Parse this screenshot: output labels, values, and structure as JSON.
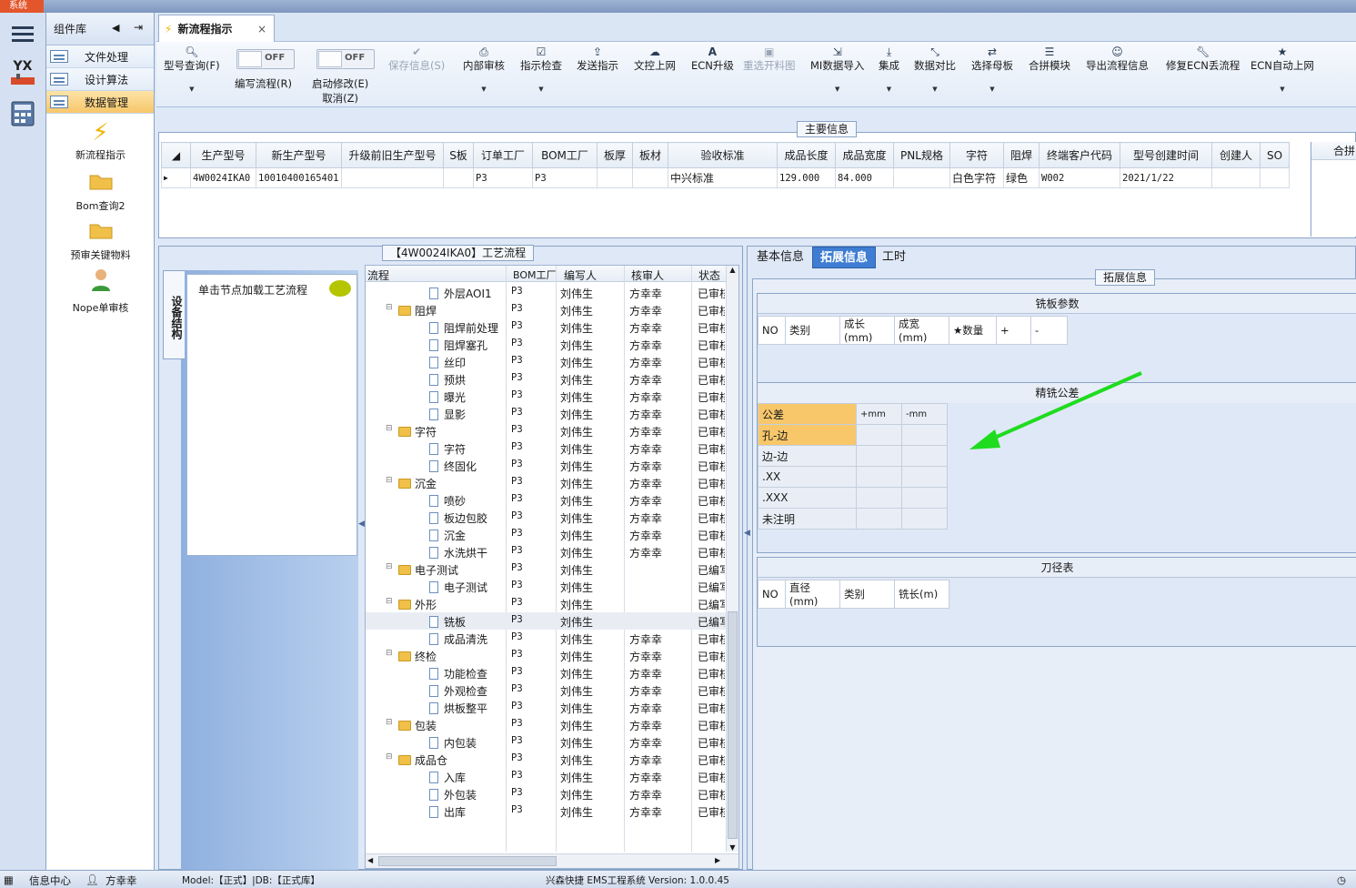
{
  "window": {
    "system_label": "系统"
  },
  "component_library": {
    "title": "组件库",
    "items": [
      {
        "label": "文件处理"
      },
      {
        "label": "设计算法"
      },
      {
        "label": "数据管理"
      }
    ],
    "tools": [
      {
        "label": "新流程指示",
        "icon": "lightning-icon"
      },
      {
        "label": "Bom查询2",
        "icon": "folder-icon"
      },
      {
        "label": "预审关键物料",
        "icon": "folder-icon"
      },
      {
        "label": "Nope单审核",
        "icon": "user-icon"
      }
    ]
  },
  "rail": {
    "logo": "YX"
  },
  "document_tab": {
    "title": "新流程指示",
    "close": "×"
  },
  "ribbon": {
    "buttons": [
      {
        "label": "型号查询(F)",
        "icon": "search-icon",
        "dropdown": true
      },
      {
        "label": "编写流程(R)",
        "toggle": "OFF"
      },
      {
        "label": "启动修改(E)",
        "label2": "取消(Z)",
        "toggle": "OFF"
      },
      {
        "label": "保存信息(S)",
        "icon": "check-icon",
        "disabled": true
      },
      {
        "label": "内部审核",
        "icon": "print-icon",
        "dropdown": true
      },
      {
        "label": "指示检查",
        "icon": "checkbox-icon",
        "dropdown": true
      },
      {
        "label": "发送指示",
        "icon": "upload-icon"
      },
      {
        "label": "文控上网",
        "icon": "cloud-upload-icon"
      },
      {
        "label": "ECN升级",
        "icon": "font-icon"
      },
      {
        "label": "重选开料图",
        "icon": "image-icon",
        "disabled": true
      },
      {
        "label": "MI数据导入",
        "icon": "import-icon",
        "dropdown": true
      },
      {
        "label": "集成",
        "icon": "download-icon",
        "dropdown": true
      },
      {
        "label": "数据对比",
        "icon": "compress-icon",
        "dropdown": true
      },
      {
        "label": "选择母板",
        "icon": "shuffle-icon",
        "dropdown": true
      },
      {
        "label": "合拼模块",
        "icon": "list-icon"
      },
      {
        "label": "导出流程信息",
        "icon": "smile-icon"
      },
      {
        "label": "修复ECN丢流程",
        "icon": "wrench-icon"
      },
      {
        "label": "ECN自动上网",
        "icon": "star-icon",
        "dropdown": true
      }
    ]
  },
  "main_info": {
    "title": "主要信息",
    "side_header": "合拼",
    "columns": [
      "生产型号",
      "新生产型号",
      "升级前旧生产型号",
      "S板",
      "订单工厂",
      "BOM工厂",
      "板厚",
      "板材",
      "验收标准",
      "成品长度",
      "成品宽度",
      "PNL规格",
      "字符",
      "阻焊",
      "终端客户代码",
      "型号创建时间",
      "创建人",
      "SO"
    ],
    "row": [
      "4W0024IKA0",
      "10010400165401",
      "",
      "",
      "P3",
      "P3",
      "",
      "",
      "中兴标准",
      "129.000",
      "84.000",
      "",
      "白色字符",
      "绿色",
      "W002",
      "2021/1/22",
      "",
      ""
    ]
  },
  "process": {
    "title": "【4W0024IKA0】工艺流程",
    "vertical_tab": "设备结构",
    "hint": "单击节点加载工艺流程",
    "columns": [
      "流程",
      "BOM工厂",
      "编写人",
      "核审人",
      "状态"
    ],
    "rows": [
      {
        "name": "外层AOI1",
        "level": 1,
        "bom": "P3",
        "writer": "刘伟生",
        "reviewer": "方幸幸",
        "status": "已审核"
      },
      {
        "name": "阻焊",
        "level": 0,
        "bom": "P3",
        "writer": "刘伟生",
        "reviewer": "方幸幸",
        "status": "已审核"
      },
      {
        "name": "阻焊前处理",
        "level": 1,
        "bom": "P3",
        "writer": "刘伟生",
        "reviewer": "方幸幸",
        "status": "已审核"
      },
      {
        "name": "阻焊塞孔",
        "level": 1,
        "bom": "P3",
        "writer": "刘伟生",
        "reviewer": "方幸幸",
        "status": "已审核"
      },
      {
        "name": "丝印",
        "level": 1,
        "bom": "P3",
        "writer": "刘伟生",
        "reviewer": "方幸幸",
        "status": "已审核"
      },
      {
        "name": "预烘",
        "level": 1,
        "bom": "P3",
        "writer": "刘伟生",
        "reviewer": "方幸幸",
        "status": "已审核"
      },
      {
        "name": "曝光",
        "level": 1,
        "bom": "P3",
        "writer": "刘伟生",
        "reviewer": "方幸幸",
        "status": "已审核"
      },
      {
        "name": "显影",
        "level": 1,
        "bom": "P3",
        "writer": "刘伟生",
        "reviewer": "方幸幸",
        "status": "已审核"
      },
      {
        "name": "字符",
        "level": 0,
        "bom": "P3",
        "writer": "刘伟生",
        "reviewer": "方幸幸",
        "status": "已审核"
      },
      {
        "name": "字符",
        "level": 1,
        "bom": "P3",
        "writer": "刘伟生",
        "reviewer": "方幸幸",
        "status": "已审核"
      },
      {
        "name": "终固化",
        "level": 1,
        "bom": "P3",
        "writer": "刘伟生",
        "reviewer": "方幸幸",
        "status": "已审核"
      },
      {
        "name": "沉金",
        "level": 0,
        "bom": "P3",
        "writer": "刘伟生",
        "reviewer": "方幸幸",
        "status": "已审核"
      },
      {
        "name": "喷砂",
        "level": 1,
        "bom": "P3",
        "writer": "刘伟生",
        "reviewer": "方幸幸",
        "status": "已审核"
      },
      {
        "name": "板边包胶",
        "level": 1,
        "bom": "P3",
        "writer": "刘伟生",
        "reviewer": "方幸幸",
        "status": "已审核"
      },
      {
        "name": "沉金",
        "level": 1,
        "bom": "P3",
        "writer": "刘伟生",
        "reviewer": "方幸幸",
        "status": "已审核"
      },
      {
        "name": "水洗烘干",
        "level": 1,
        "bom": "P3",
        "writer": "刘伟生",
        "reviewer": "方幸幸",
        "status": "已审核"
      },
      {
        "name": "电子测试",
        "level": 0,
        "bom": "P3",
        "writer": "刘伟生",
        "reviewer": "",
        "status": "已编写"
      },
      {
        "name": "电子测试",
        "level": 1,
        "bom": "P3",
        "writer": "刘伟生",
        "reviewer": "",
        "status": "已编写"
      },
      {
        "name": "外形",
        "level": 0,
        "bom": "P3",
        "writer": "刘伟生",
        "reviewer": "",
        "status": "已编写"
      },
      {
        "name": "铣板",
        "level": 1,
        "bom": "P3",
        "writer": "刘伟生",
        "reviewer": "",
        "status": "已编写",
        "selected": true
      },
      {
        "name": "成品清洗",
        "level": 1,
        "bom": "P3",
        "writer": "刘伟生",
        "reviewer": "方幸幸",
        "status": "已审核"
      },
      {
        "name": "终检",
        "level": 0,
        "bom": "P3",
        "writer": "刘伟生",
        "reviewer": "方幸幸",
        "status": "已审核"
      },
      {
        "name": "功能检查",
        "level": 1,
        "bom": "P3",
        "writer": "刘伟生",
        "reviewer": "方幸幸",
        "status": "已审核"
      },
      {
        "name": "外观检查",
        "level": 1,
        "bom": "P3",
        "writer": "刘伟生",
        "reviewer": "方幸幸",
        "status": "已审核"
      },
      {
        "name": "烘板整平",
        "level": 1,
        "bom": "P3",
        "writer": "刘伟生",
        "reviewer": "方幸幸",
        "status": "已审核"
      },
      {
        "name": "包装",
        "level": 0,
        "bom": "P3",
        "writer": "刘伟生",
        "reviewer": "方幸幸",
        "status": "已审核"
      },
      {
        "name": "内包装",
        "level": 1,
        "bom": "P3",
        "writer": "刘伟生",
        "reviewer": "方幸幸",
        "status": "已审核"
      },
      {
        "name": "成品仓",
        "level": 0,
        "bom": "P3",
        "writer": "刘伟生",
        "reviewer": "方幸幸",
        "status": "已审核"
      },
      {
        "name": "入库",
        "level": 1,
        "bom": "P3",
        "writer": "刘伟生",
        "reviewer": "方幸幸",
        "status": "已审核"
      },
      {
        "name": "外包装",
        "level": 1,
        "bom": "P3",
        "writer": "刘伟生",
        "reviewer": "方幸幸",
        "status": "已审核"
      },
      {
        "name": "出库",
        "level": 1,
        "bom": "P3",
        "writer": "刘伟生",
        "reviewer": "方幸幸",
        "status": "已审核"
      }
    ]
  },
  "right": {
    "tabs": [
      "基本信息",
      "拓展信息",
      "工时"
    ],
    "active_tab": "拓展信息",
    "ext_title": "拓展信息",
    "mill_params": {
      "title": "铣板参数",
      "columns": [
        "NO",
        "类别",
        "成长(mm)",
        "成宽(mm)",
        "★数量",
        "+",
        "-"
      ]
    },
    "tolerance": {
      "title": "精铣公差",
      "header": [
        "公差",
        "+mm",
        "-mm"
      ],
      "rows": [
        "孔-边",
        "边-边",
        ".XX",
        ".XXX",
        "未注明"
      ]
    },
    "tool_table": {
      "title": "刀径表",
      "columns": [
        "NO",
        "直径(mm)",
        "类别",
        "铣长(m)"
      ]
    }
  },
  "status_bar": {
    "info_center": "信息中心",
    "user": "方幸幸",
    "model": "Model:【正式】|DB:【正式库】",
    "app": "兴森快捷 EMS工程系统 Version: 1.0.0.45"
  },
  "colors": {
    "accent": "#3e7dd1",
    "selected": "#f7c76a",
    "arrow": "#1fdc1f"
  }
}
